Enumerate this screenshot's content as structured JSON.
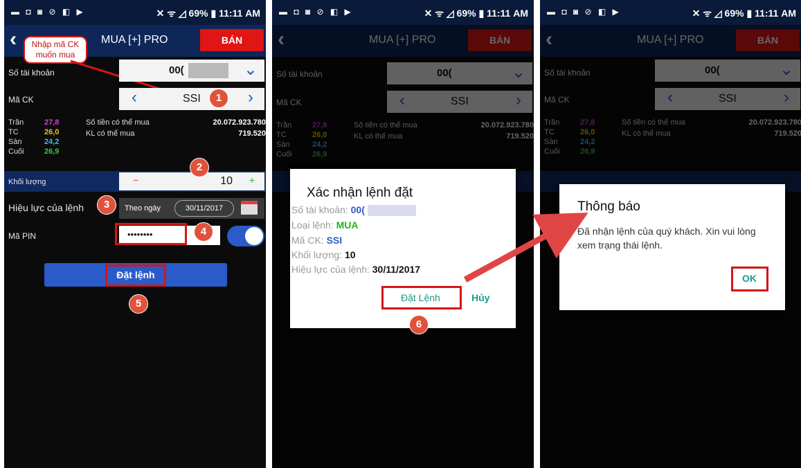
{
  "status": {
    "left_icons": "▬ ◘ ◙ ⊘ ◧ ▶",
    "right": "✕ ᯤ ◿ 69% ▮ 11:11 AM"
  },
  "header": {
    "back": "‹",
    "title": "MUA [+] PRO",
    "sell": "BÁN"
  },
  "callout": {
    "text": "Nhập mã CK muốn mua"
  },
  "form": {
    "account_label": "Số tài khoản",
    "account_value": "00(",
    "symbol_label": "Mã CK",
    "symbol_value": "SSI",
    "prev": "‹",
    "next": "›",
    "chevron": "⌄",
    "tran_label": "Trần",
    "tran_value": "27,8",
    "tc_label": "TC",
    "tc_value": "26,0",
    "san_label": "Sàn",
    "san_value": "24,2",
    "cuoi_label": "Cuối",
    "cuoi_value": "26,9",
    "cash_label": "Số tiền có thể mua",
    "cash_value": "20.072.923.780",
    "qty_avail_label": "KL có thể mua",
    "qty_avail_value": "719.520",
    "volume_label": "Khối lượng",
    "volume_value": "10",
    "minus": "−",
    "plus": "+",
    "validity_label": "Hiệu lực của lệnh",
    "validity_type": "Theo ngày",
    "validity_date": "30/11/2017",
    "pin_label": "Mã PIN",
    "pin_value": "••••••••",
    "submit": "Đặt lệnh"
  },
  "steps": [
    "1",
    "2",
    "3",
    "4",
    "5",
    "6"
  ],
  "confirm": {
    "title": "Xác nhận lệnh đặt",
    "account_label": "Số tài khoản:",
    "account_value": "00(",
    "type_label": "Loại lệnh:",
    "type_value": "MUA",
    "symbol_label": "Mã CK:",
    "symbol_value": "SSI",
    "volume_label": "Khối lượng:",
    "volume_value": "10",
    "validity_label": "Hiệu lực của lệnh:",
    "validity_value": "30/11/2017",
    "ok": "Đặt Lệnh",
    "cancel": "Hủy"
  },
  "notice": {
    "title": "Thông báo",
    "message": "Đã nhận lệnh của quý khách. Xin vui lòng xem trạng thái lệnh.",
    "ok": "OK"
  },
  "colors": {
    "tran": "#d040d0",
    "tc": "#e0d000",
    "san": "#3fc0e0",
    "cuoi": "#30d040",
    "accent": "#2a5bc8",
    "sell": "#e01515"
  }
}
